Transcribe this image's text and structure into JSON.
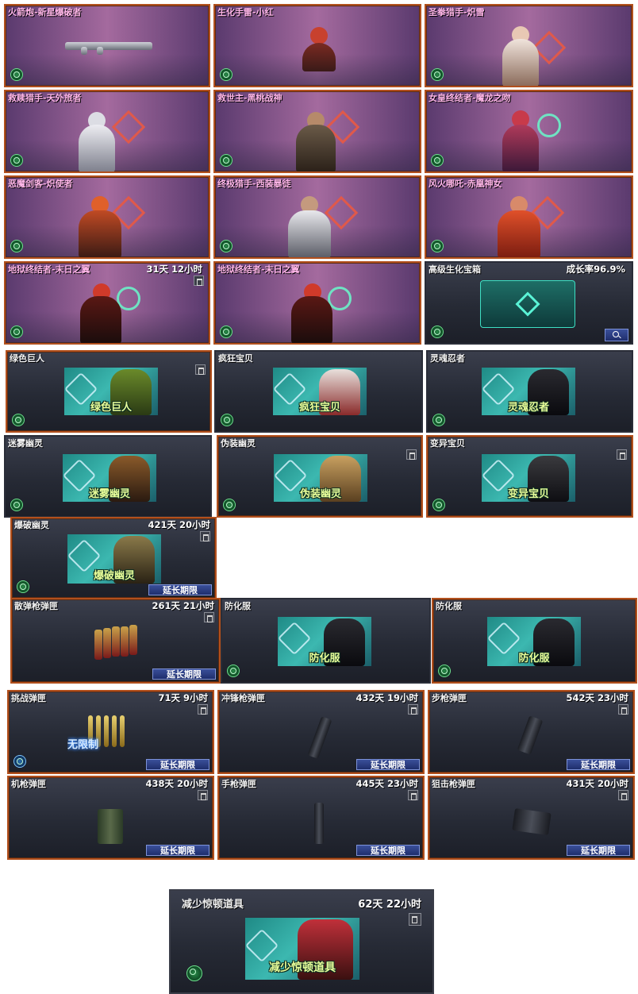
{
  "colors": {
    "purple_bg": "#a46a9e",
    "border_orange": "#b2501d",
    "banner_teal": "#3cb8b0",
    "label_yellow": "#e8ff9a",
    "button_blue": "#2c3f88"
  },
  "row1": [
    {
      "name": "火箭炮-新星爆破者"
    },
    {
      "name": "生化手雷-小红"
    },
    {
      "name": "圣拳猎手-炽雪"
    }
  ],
  "row2": [
    {
      "name": "救赎猎手-天外旅者"
    },
    {
      "name": "救世主-黑桃战神"
    },
    {
      "name": "女皇终结者-魔龙之吻"
    }
  ],
  "row3": [
    {
      "name": "恶魔剑客-炽使者"
    },
    {
      "name": "终极猎手-西装暴徒"
    },
    {
      "name": "风火哪吒-赤凰神女"
    }
  ],
  "row4": [
    {
      "name": "地狱终结者-末日之翼",
      "time": "31天 12小时"
    },
    {
      "name": "地狱终结者-末日之翼"
    },
    {
      "name": "高级生化宝箱",
      "growth": "成长率96.9%"
    }
  ],
  "row5": [
    {
      "name": "绿色巨人",
      "banner": "绿色巨人"
    },
    {
      "name": "疯狂宝贝",
      "banner": "疯狂宝贝"
    },
    {
      "name": "灵魂忍者",
      "banner": "灵魂忍者"
    }
  ],
  "row6": [
    {
      "name": "迷雾幽灵",
      "banner": "迷雾幽灵"
    },
    {
      "name": "伪装幽灵",
      "banner": "伪装幽灵"
    },
    {
      "name": "变异宝贝",
      "banner": "变异宝贝"
    }
  ],
  "row7": {
    "name": "爆破幽灵",
    "time": "421天 20小时",
    "banner": "爆破幽灵",
    "extend": "延长期限"
  },
  "row8": [
    {
      "name": "散弹枪弹匣",
      "time": "261天 21小时",
      "extend": "延长期限"
    },
    {
      "name": "防化服",
      "banner": "防化服"
    },
    {
      "name": "防化服",
      "banner": "防化服"
    }
  ],
  "row9": [
    {
      "name": "挑战弹匣",
      "time": "71天 9小时",
      "extend": "延长期限",
      "art_label": "无限制"
    },
    {
      "name": "冲锋枪弹匣",
      "time": "432天 19小时",
      "extend": "延长期限"
    },
    {
      "name": "步枪弹匣",
      "time": "542天 23小时",
      "extend": "延长期限"
    }
  ],
  "row10": [
    {
      "name": "机枪弹匣",
      "time": "438天 20小时",
      "extend": "延长期限"
    },
    {
      "name": "手枪弹匣",
      "time": "445天 23小时",
      "extend": "延长期限"
    },
    {
      "name": "狙击枪弹匣",
      "time": "431天 20小时",
      "extend": "延长期限"
    }
  ],
  "row11": {
    "name": "减少惊顿道具",
    "time": "62天 22小时",
    "banner": "减少惊顿道具"
  }
}
